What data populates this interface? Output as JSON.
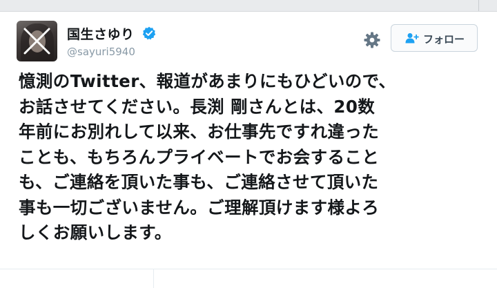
{
  "tweet": {
    "display_name": "国生さゆり",
    "handle": "@sayuri5940",
    "verified_icon": "verified-check-icon",
    "verified_color": "#1da1f2",
    "follow_label": "フォロー",
    "follow_icon": "add-user-icon",
    "settings_icon": "gear-icon",
    "text_lines": [
      "憶測のTwitter、報道があまりにもひどいので、",
      "お話させてください。長渕 剛さんとは、20数",
      "年前にお別れして以来、お仕事先ですれ違った",
      "ことも、もちろんプライベートでお会すること",
      "も、ご連絡を頂いた事も、ご連絡させて頂いた",
      "事も一切ございません。ご理解頂けます様よろ",
      "しくお願いします。"
    ]
  },
  "colors": {
    "text": "#14171a",
    "muted": "#8899a6",
    "accent": "#1da1f2"
  }
}
